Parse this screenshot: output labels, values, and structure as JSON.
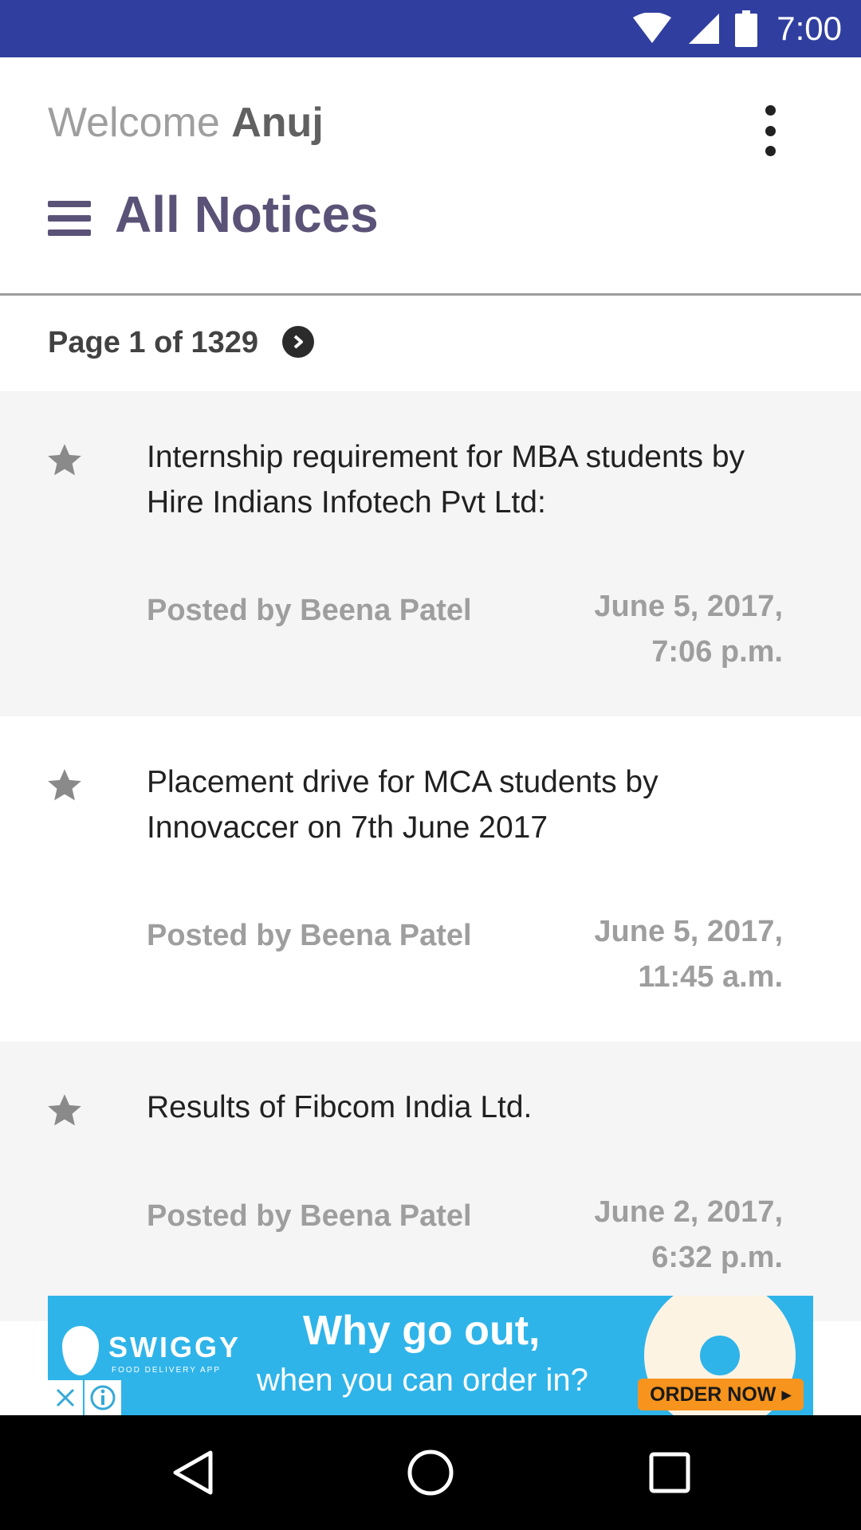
{
  "status_bar": {
    "time": "7:00",
    "icons": [
      "wifi-icon",
      "signal-icon",
      "battery-icon"
    ],
    "color": "#303f9f"
  },
  "header": {
    "welcome_prefix": "Welcome",
    "user_name": "Anuj",
    "title": "All Notices",
    "accent_color": "#5b5277"
  },
  "pager": {
    "label": "Page 1 of 1329"
  },
  "notices": [
    {
      "title": "Internship requirement for MBA students by Hire Indians Infotech Pvt Ltd:",
      "author": "Posted by Beena Patel",
      "date_line1": "June 5, 2017,",
      "date_line2": "7:06 p.m."
    },
    {
      "title": "Placement drive for MCA students by Innovaccer on 7th June 2017",
      "author": "Posted by Beena Patel",
      "date_line1": "June 5, 2017,",
      "date_line2": "11:45 a.m."
    },
    {
      "title": "Results of Fibcom India Ltd.",
      "author": "Posted by Beena Patel",
      "date_line1": "June 2, 2017,",
      "date_line2": "6:32 p.m."
    }
  ],
  "ad": {
    "brand": "SWIGGY",
    "brand_sub": "FOOD DELIVERY APP",
    "headline": "Why go out,",
    "subline": "when you can order in?",
    "cta": "ORDER NOW ▸",
    "background": "#2fb4e9"
  },
  "nav": {
    "icons": [
      "back-icon",
      "home-icon",
      "recents-icon"
    ]
  }
}
